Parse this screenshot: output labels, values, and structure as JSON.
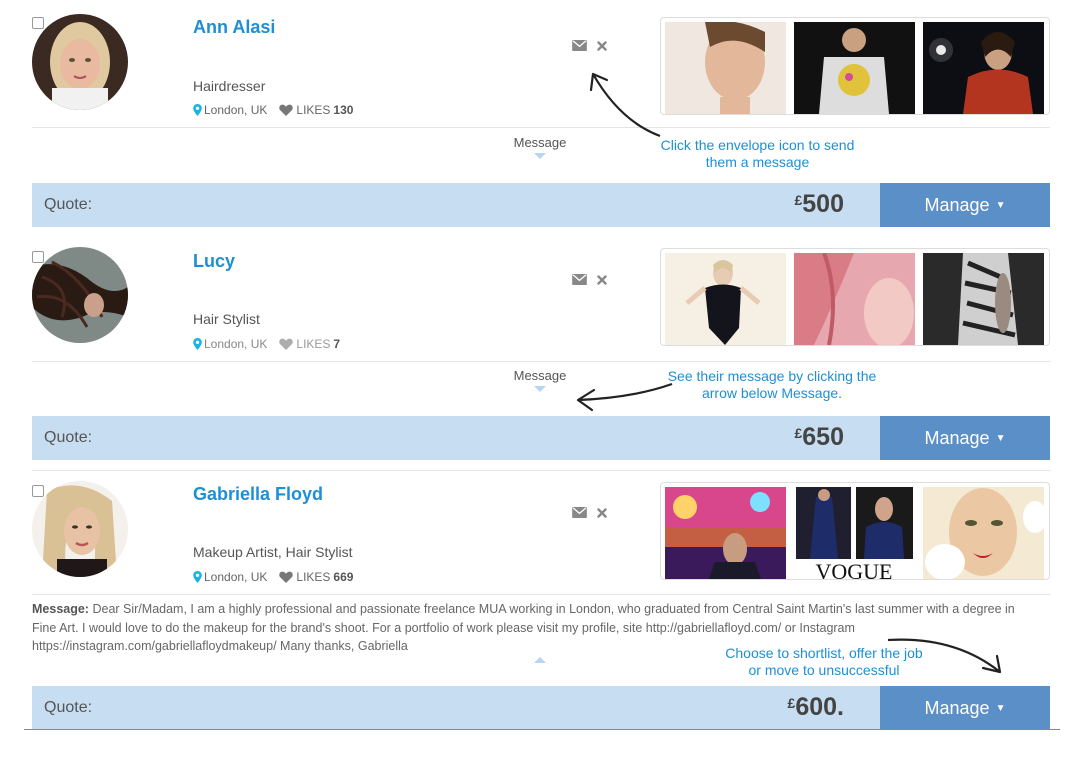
{
  "colors": {
    "accent": "#1e8fd5",
    "quote_bar": "#c7ddf2",
    "manage_button": "#5b8fc7",
    "annotation": "#1e8fd5"
  },
  "candidates": [
    {
      "name": "Ann Alasi",
      "role": "Hairdresser",
      "location": "London, UK",
      "likes_label": "LIKES",
      "likes": "130",
      "message_toggle": "Message",
      "quote_label": "Quote:",
      "currency": "£",
      "price": "500",
      "manage_label": "Manage"
    },
    {
      "name": "Lucy",
      "role": "Hair Stylist",
      "location": "London, UK",
      "likes_label": "LIKES",
      "likes": "7",
      "message_toggle": "Message",
      "quote_label": "Quote:",
      "currency": "£",
      "price": "650",
      "manage_label": "Manage"
    },
    {
      "name": "Gabriella Floyd",
      "role": "Makeup Artist, Hair Stylist",
      "location": "London, UK",
      "likes_label": "LIKES",
      "likes": "669",
      "message_label": "Message:",
      "message_text": "Dear Sir/Madam, I am a highly professional and passionate freelance MUA working in London, who graduated from Central Saint Martin's last summer with a degree in Fine Art. I would love to do the makeup for the brand's shoot. For a portfolio of work please visit my profile, site http://gabriellafloyd.com/ or Instagram https://instagram.com/gabriellafloydmakeup/ Many thanks, Gabriella",
      "quote_label": "Quote:",
      "currency": "£",
      "price": "600.",
      "manage_label": "Manage"
    }
  ],
  "annotations": {
    "envelope_line1": "Click the envelope icon to send",
    "envelope_line2": "them a message",
    "message_line1": "See their message by clicking the",
    "message_line2": "arrow below Message.",
    "manage_line1": "Choose to shortlist, offer the job",
    "manage_line2": "or move to unsuccessful"
  },
  "gallery_text": {
    "vogue": "VOGUE"
  },
  "icons": [
    "checkbox-icon",
    "envelope-icon",
    "close-icon",
    "map-pin-icon",
    "heart-icon",
    "caret-down-icon",
    "caret-up-icon"
  ]
}
